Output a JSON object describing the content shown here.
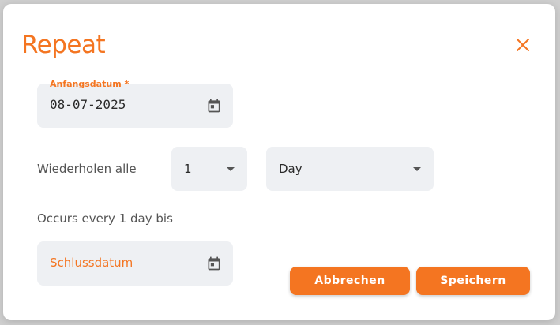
{
  "dialog": {
    "title": "Repeat",
    "close_icon": "close-icon"
  },
  "start_date": {
    "label": "Anfangsdatum *",
    "value": "08-07-2025",
    "icon": "calendar-icon"
  },
  "repeat": {
    "label": "Wiederholen alle",
    "interval_value": "1",
    "unit_value": "Day"
  },
  "summary": {
    "text": "Occurs every 1 day bis"
  },
  "end_date": {
    "placeholder": "Schlussdatum",
    "icon": "calendar-icon"
  },
  "buttons": {
    "cancel_label": "Abbrechen",
    "save_label": "Speichern"
  },
  "colors": {
    "accent": "#f47521",
    "field_bg": "#eef0f3"
  }
}
